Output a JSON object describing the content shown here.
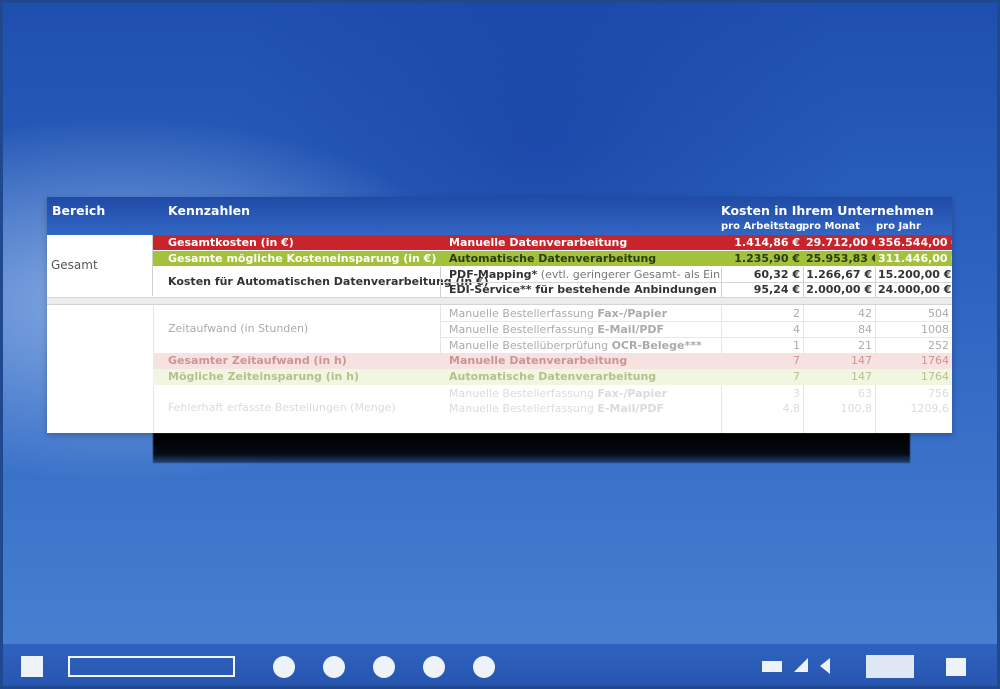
{
  "table": {
    "header": {
      "bereich": "Bereich",
      "kennzahlen": "Kennzahlen",
      "kosten": "Kosten in Ihrem Unternehmen",
      "sub": [
        "pro Arbeitstag",
        "pro Monat",
        "pro Jahr"
      ]
    },
    "bereich_gesamt": "Gesamt",
    "cost_rows": [
      {
        "label": "Gesamtkosten (in €)",
        "desc": "Manuelle Datenverarbeitung",
        "tag": "",
        "v": [
          "1.414,86 €",
          "29.712,00 €",
          "356.544,00 €"
        ]
      },
      {
        "label": "Gesamte mögliche Kosteneinsparung (in €)",
        "desc": "Automatische Datenverarbeitung",
        "tag": "",
        "v": [
          "1.235,90 €",
          "25.953,83 €",
          "311.446,00 €"
        ]
      },
      {
        "label": "Kosten für Automatischen Datenverarbeitung (in €)",
        "desc": "PDF-Mapping*",
        "tag": " (evtl. geringerer Gesamt- als Einzelprei•",
        "v": [
          "60,32 €",
          "1.266,67 €",
          "15.200,00 €"
        ]
      },
      {
        "label": "",
        "desc": "EDI-Service** für bestehende Anbindungen",
        "tag": "",
        "v": [
          "95,24 €",
          "2.000,00 €",
          "24.000,00 €"
        ]
      }
    ],
    "time_label": "Zeitaufwand (in Stunden)",
    "time_rows": [
      {
        "desc": "Manuelle Bestellerfassung ",
        "bold": "Fax-/Papier",
        "v": [
          "2",
          "42",
          "504"
        ]
      },
      {
        "desc": "Manuelle Bestellerfassung ",
        "bold": "E-Mail/PDF",
        "v": [
          "4",
          "84",
          "1008"
        ]
      },
      {
        "desc": "Manuelle Bestellüberprüfung ",
        "bold": "OCR-Belege***",
        "v": [
          "1",
          "21",
          "252"
        ]
      }
    ],
    "total_time": {
      "label": "Gesamter Zeitaufwand (in h)",
      "desc": "Manuelle Datenverarbeitung",
      "v": [
        "7",
        "147",
        "1764"
      ]
    },
    "savings_time": {
      "label": "Mögliche Zeiteinsparung (in h)",
      "desc": "Automatische Datenverarbeitung",
      "v": [
        "7",
        "147",
        "1764"
      ]
    },
    "error_label": "Fehlerhaft erfasste Bestellungen (Menge)",
    "error_rows": [
      {
        "desc": "Manuelle Bestellerfassung ",
        "bold": "Fax-/Papier",
        "v": [
          "3",
          "63",
          "756"
        ]
      },
      {
        "desc": "Manuelle Bestellerfassung ",
        "bold": "E-Mail/PDF",
        "v": [
          "4,8",
          "100,8",
          "1209,6"
        ]
      }
    ]
  },
  "colors": {
    "header_blue": "#2a5bb8",
    "red_row": "#c8242b",
    "green_row": "#a4c13c",
    "pink_row": "#f3c9c9",
    "light_green_row": "#e6efc9"
  },
  "toolbar": {
    "icons": [
      "stop-icon",
      "progress-bar",
      "dot-icon",
      "dot-icon",
      "dot-icon",
      "dot-icon",
      "dot-icon",
      "volume-icon",
      "fullscreen-icon",
      "menu-icon"
    ]
  }
}
